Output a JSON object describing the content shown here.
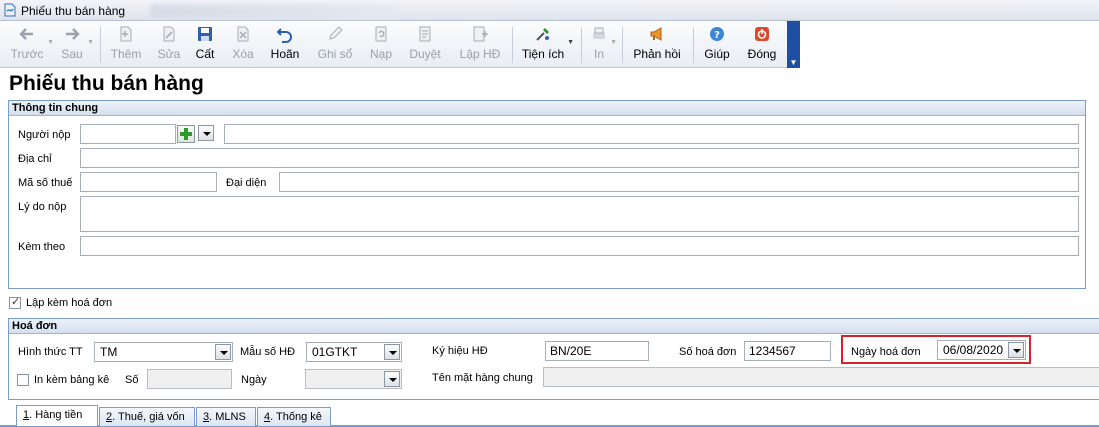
{
  "window": {
    "title": "Phiếu thu bán hàng"
  },
  "toolbar": {
    "items": [
      {
        "label": "Trước",
        "icon": "arrow-left-icon",
        "enabled": false
      },
      {
        "label": "Sau",
        "icon": "arrow-right-icon",
        "enabled": false
      },
      {
        "label": "Thêm",
        "icon": "add-document-icon",
        "enabled": false
      },
      {
        "label": "Sửa",
        "icon": "edit-document-icon",
        "enabled": false
      },
      {
        "label": "Cất",
        "icon": "save-icon",
        "enabled": true
      },
      {
        "label": "Xóa",
        "icon": "delete-icon",
        "enabled": false
      },
      {
        "label": "Hoãn",
        "icon": "undo-icon",
        "enabled": true
      },
      {
        "label": "Ghi sổ",
        "icon": "pencil-icon",
        "enabled": false
      },
      {
        "label": "Nạp",
        "icon": "reload-icon",
        "enabled": false
      },
      {
        "label": "Duyệt",
        "icon": "approve-icon",
        "enabled": false
      },
      {
        "label": "Lập HĐ",
        "icon": "create-invoice-icon",
        "enabled": false
      },
      {
        "label": "Tiện ích",
        "icon": "tools-icon",
        "enabled": true
      },
      {
        "label": "In",
        "icon": "printer-icon",
        "enabled": false
      },
      {
        "label": "Phản hồi",
        "icon": "megaphone-icon",
        "enabled": true
      },
      {
        "label": "Giúp",
        "icon": "help-icon",
        "enabled": true
      },
      {
        "label": "Đóng",
        "icon": "close-icon",
        "enabled": true
      }
    ]
  },
  "page": {
    "title": "Phiếu thu bán hàng"
  },
  "general": {
    "heading": "Thông tin chung",
    "payer_label": "Người nộp",
    "payer_code": "",
    "payer_name": "",
    "address_label": "Địa chỉ",
    "address": "",
    "tax_code_label": "Mã số thuế",
    "tax_code": "",
    "representative_label": "Đại diện",
    "representative": "",
    "reason_label": "Lý do nộp",
    "reason": "",
    "attachment_label": "Kèm theo",
    "attachment": ""
  },
  "invoice_with": {
    "label": "Lập kèm hoá đơn",
    "checked": true
  },
  "invoice": {
    "heading": "Hoá đơn",
    "payment_method_label": "Hình thức TT",
    "payment_method": "TM",
    "template_label": "Mẫu số HĐ",
    "template": "01GTKT",
    "symbol_label": "Ký hiệu HĐ",
    "symbol": "BN/20E",
    "number_label": "Số hoá đơn",
    "number": "1234567",
    "date_label": "Ngày hoá đơn",
    "date": "06/08/2020",
    "print_list_label": "In kèm bảng kê",
    "print_list_checked": false,
    "list_no_label": "Số",
    "list_no": "",
    "list_date_label": "Ngày",
    "list_date": "",
    "common_item_label": "Tên mặt hàng chung",
    "common_item": ""
  },
  "tabs": [
    {
      "key": "1",
      "label": ". Hàng tiền"
    },
    {
      "key": "2",
      "label": ". Thuế, giá vốn"
    },
    {
      "key": "3",
      "label": ". MLNS"
    },
    {
      "key": "4",
      "label": ". Thống kê"
    }
  ],
  "colors": {
    "accent": "#1f4fa3",
    "highlight_border": "#d8232a",
    "group_border": "#7b9bc9"
  }
}
